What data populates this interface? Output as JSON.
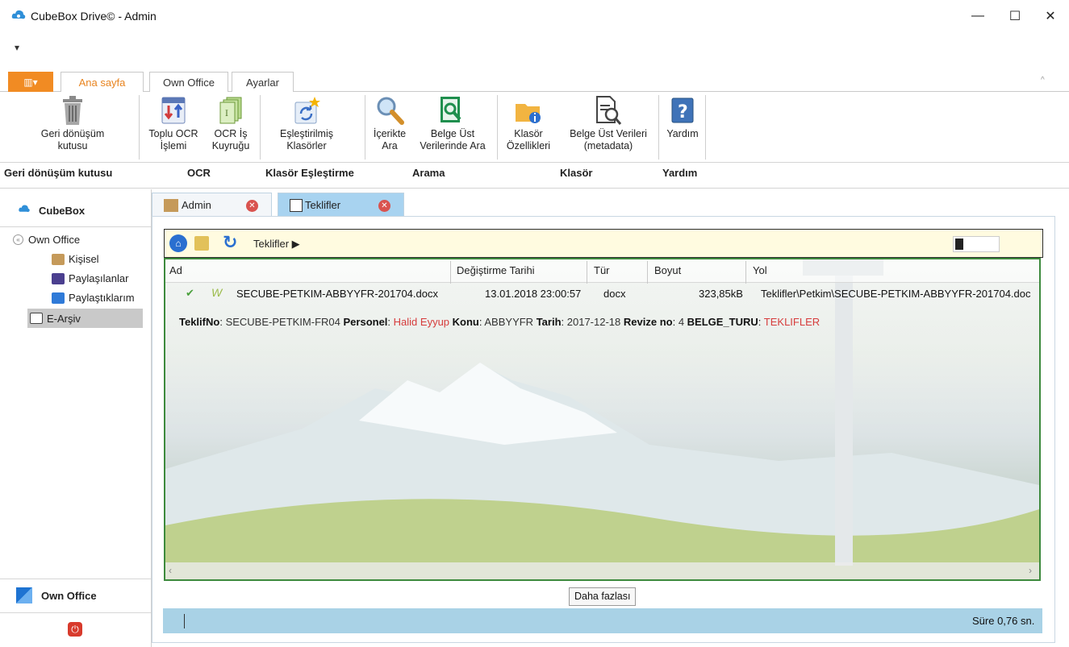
{
  "window": {
    "title": "CubeBox Drive© - Admin",
    "controls": [
      "—",
      "☐",
      "✕"
    ]
  },
  "qat": {
    "dropdown": "▾"
  },
  "ribbon_tabs": {
    "file_glyph": "▥▾",
    "tabs": [
      "Ana sayfa",
      "Own Office",
      "Ayarlar"
    ],
    "collapse": "^"
  },
  "ribbon": {
    "recycle": {
      "line1": "Geri dönüşüm",
      "line2": "kutusu"
    },
    "bulk_ocr": {
      "line1": "Toplu OCR",
      "line2": "İşlemi"
    },
    "ocr_queue": {
      "line1": "OCR İş",
      "line2": "Kuyruğu"
    },
    "matched": {
      "line1": "Eşleştirilmiş",
      "line2": "Klasörler"
    },
    "search_content": {
      "line1": "İçerikte",
      "line2": "Ara"
    },
    "search_meta": {
      "line1": "Belge Üst",
      "line2": "Verilerinde Ara"
    },
    "folder_props": {
      "line1": "Klasör",
      "line2": "Özellikleri"
    },
    "metadata": {
      "line1": "Belge Üst Verileri",
      "line2": "(metadata)"
    },
    "help": {
      "line1": "Yardım"
    },
    "groups": [
      "Geri dönüşüm kutusu",
      "OCR",
      "Klasör Eşleştirme",
      "Arama",
      "Klasör",
      "Yardım"
    ]
  },
  "left_panel": {
    "header": "CubeBox",
    "tree": {
      "root": "Own Office",
      "items": [
        "Kişisel",
        "Paylaşılanlar",
        "Paylaştıklarım",
        "E-Arşiv"
      ]
    },
    "bottom": "Own Office"
  },
  "doc_tabs": [
    "Admin",
    "Teklifler"
  ],
  "navbar": {
    "path": "Teklifler ▶"
  },
  "grid": {
    "columns": [
      "Ad",
      "Değiştirme Tarihi",
      "Tür",
      "Boyut",
      "Yol"
    ],
    "rows": [
      {
        "name": "SECUBE-PETKIM-ABBYYFR-201704.docx",
        "modified": "13.01.2018 23:00:57",
        "type": "docx",
        "size": "323,85kB",
        "path": "Teklifler\\Petkim\\SECUBE-PETKIM-ABBYYFR-201704.doc"
      }
    ],
    "meta": {
      "k1": "TeklifNo",
      "v1": "SECUBE-PETKIM-FR04",
      "k2": "Personel",
      "v2": "Halid Eyyup",
      "k3": "Konu",
      "v3": "ABBYYFR",
      "k4": "Tarih",
      "v4": "2017-12-18",
      "k5": "Revize no",
      "v5": "4",
      "k6": "BELGE_TURU",
      "v6": "TEKLIFLER"
    }
  },
  "more_button": "Daha fazlası",
  "status": {
    "time": "Süre 0,76 sn."
  },
  "colors": {
    "accent": "#f18b23",
    "status": "#a9d2e6",
    "grid_border": "#3d8a3d"
  }
}
